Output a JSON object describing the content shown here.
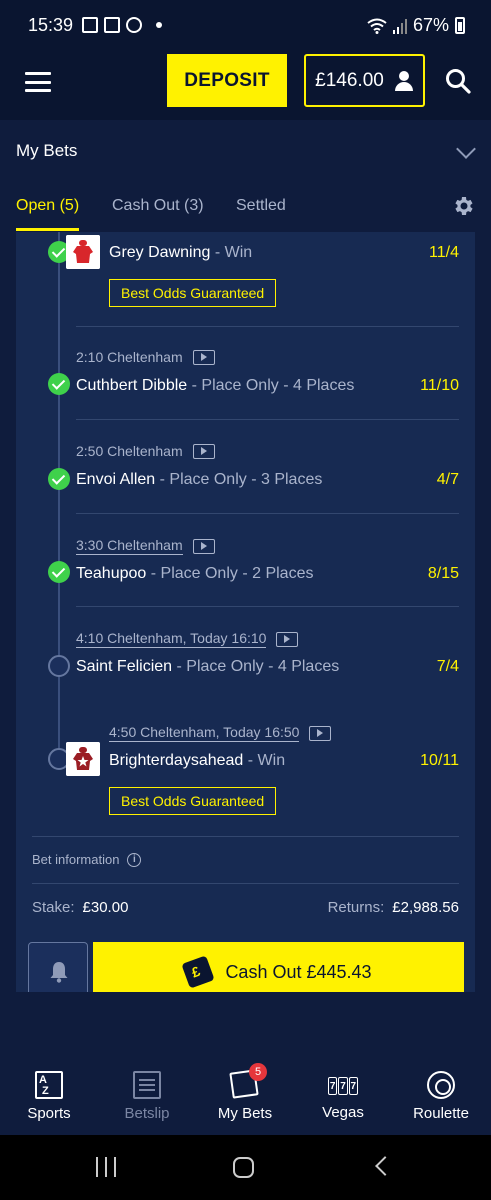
{
  "status_bar": {
    "time": "15:39",
    "battery": "67%"
  },
  "header": {
    "deposit_label": "DEPOSIT",
    "balance": "£146.00"
  },
  "my_bets": {
    "title": "My Bets"
  },
  "tabs": [
    {
      "label": "Open (5)",
      "active": true
    },
    {
      "label": "Cash Out (3)",
      "active": false
    },
    {
      "label": "Settled",
      "active": false
    }
  ],
  "legs": [
    {
      "race": "",
      "horse": "Grey Dawning",
      "market": " - Win",
      "odds": "11/4",
      "status": "won",
      "bog": "Best Odds Guaranteed"
    },
    {
      "race": "2:10 Cheltenham",
      "horse": "Cuthbert Dibble",
      "market": " - Place Only - 4 Places",
      "odds": "11/10",
      "status": "won"
    },
    {
      "race": "2:50 Cheltenham",
      "horse": "Envoi Allen",
      "market": " - Place Only - 3 Places",
      "odds": "4/7",
      "status": "won"
    },
    {
      "race": "3:30 Cheltenham",
      "horse": "Teahupoo",
      "market": " - Place Only - 2 Places",
      "odds": "8/15",
      "status": "won"
    },
    {
      "race": "4:10 Cheltenham",
      "race_time": ", Today 16:10",
      "horse": "Saint Felicien",
      "market": " - Place Only - 4 Places",
      "odds": "7/4",
      "status": "pending"
    },
    {
      "race": "4:50 Cheltenham",
      "race_time": ", Today 16:50",
      "horse": "Brighterdaysahead",
      "market": " - Win",
      "odds": "10/11",
      "status": "pending",
      "bog": "Best Odds Guaranteed"
    }
  ],
  "bet_info": {
    "label": "Bet information",
    "stake_label": "Stake:",
    "stake": "£30.00",
    "returns_label": "Returns:",
    "returns": "£2,988.56",
    "cashout_label": "Cash Out £445.43"
  },
  "bottom_nav": [
    {
      "label": "Sports",
      "icon": "a-z-icon"
    },
    {
      "label": "Betslip",
      "icon": "receipt-icon",
      "disabled": true
    },
    {
      "label": "My Bets",
      "icon": "my-bets-icon",
      "badge": "5"
    },
    {
      "label": "Vegas",
      "icon": "slot-machine-icon",
      "vegas_symbols": [
        "7",
        "7",
        "7"
      ]
    },
    {
      "label": "Roulette",
      "icon": "roulette-wheel-icon"
    }
  ],
  "colors": {
    "accent": "#fff200",
    "background": "#0f1c3d",
    "card": "#172a52",
    "won": "#3fd14b"
  }
}
